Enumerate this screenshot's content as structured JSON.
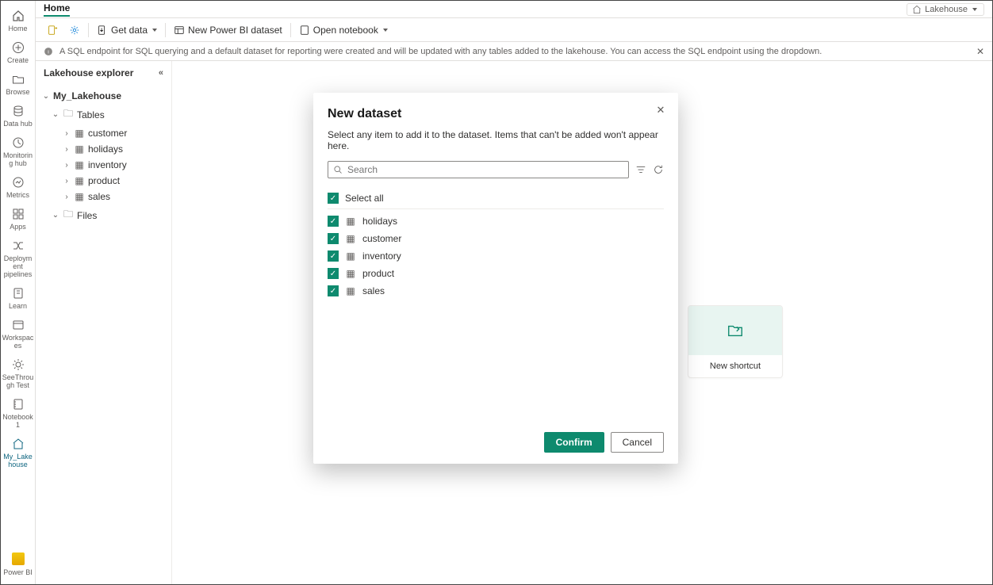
{
  "rail": {
    "items": [
      {
        "label": "Home"
      },
      {
        "label": "Create"
      },
      {
        "label": "Browse"
      },
      {
        "label": "Data hub"
      },
      {
        "label": "Monitoring hub"
      },
      {
        "label": "Metrics"
      },
      {
        "label": "Apps"
      },
      {
        "label": "Deployment pipelines"
      },
      {
        "label": "Learn"
      },
      {
        "label": "Workspaces"
      },
      {
        "label": "SeeThrough Test"
      },
      {
        "label": "Notebook 1"
      },
      {
        "label": "My_Lakehouse"
      }
    ],
    "bottom_label": "Power BI"
  },
  "topbar": {
    "crumb": "Home",
    "view_switch": "Lakehouse"
  },
  "toolbar": {
    "get_data": "Get data",
    "new_pbi": "New Power BI dataset",
    "open_nb": "Open notebook"
  },
  "infobar": {
    "text": "A SQL endpoint for SQL querying and a default dataset for reporting were created and will be updated with any tables added to the lakehouse. You can access the SQL endpoint using the dropdown."
  },
  "explorer": {
    "title": "Lakehouse explorer",
    "root": "My_Lakehouse",
    "tables_label": "Tables",
    "tables": [
      "customer",
      "holidays",
      "inventory",
      "product",
      "sales"
    ],
    "files_label": "Files"
  },
  "canvas": {
    "shortcut_label": "New shortcut"
  },
  "modal": {
    "title": "New dataset",
    "subtitle": "Select any item to add it to the dataset. Items that can't be added won't appear here.",
    "search_placeholder": "Search",
    "select_all": "Select all",
    "items": [
      "holidays",
      "customer",
      "inventory",
      "product",
      "sales"
    ],
    "confirm": "Confirm",
    "cancel": "Cancel"
  }
}
